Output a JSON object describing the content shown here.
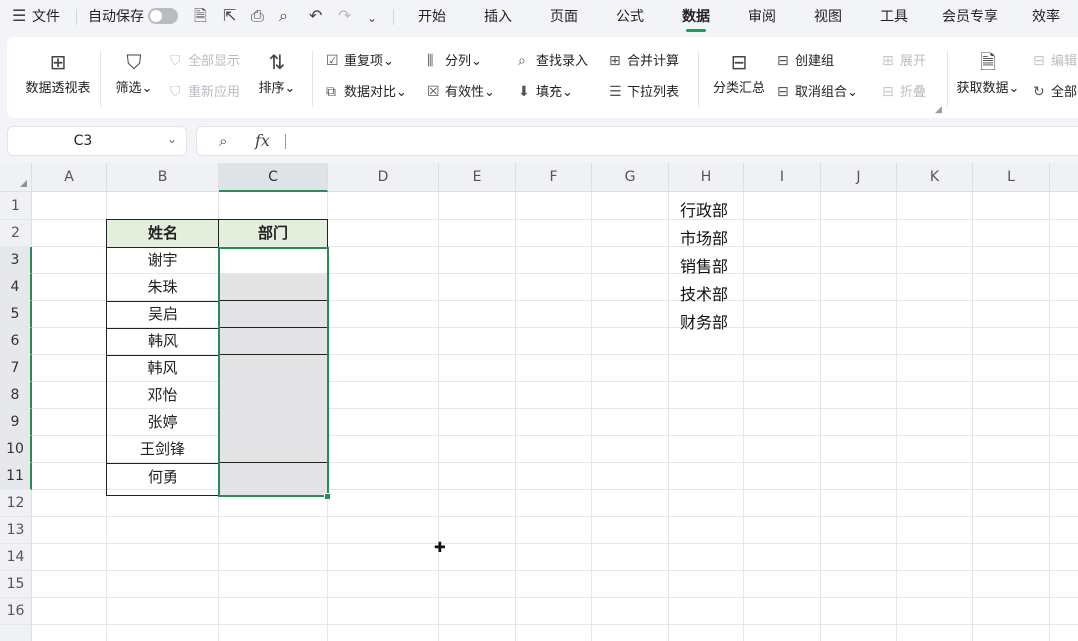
{
  "menubar": {
    "menu_icon": "☰",
    "file": "文件",
    "autosave": "自动保存",
    "tabs": [
      "开始",
      "插入",
      "页面",
      "公式",
      "数据",
      "审阅",
      "视图",
      "工具",
      "会员专享",
      "效率"
    ],
    "active_tab": "数据"
  },
  "ribbon": {
    "pivot": "数据透视表",
    "filter": "筛选",
    "show_all": "全部显示",
    "reapply": "重新应用",
    "sort": "排序",
    "duplicates": "重复项",
    "compare": "数据对比",
    "split": "分列",
    "validity": "有效性",
    "lookup": "查找录入",
    "fill": "填充",
    "consolidate": "合并计算",
    "dropdown": "下拉列表",
    "subtotal": "分类汇总",
    "group": "创建组",
    "ungroup": "取消组合",
    "expand": "展开",
    "collapse": "折叠",
    "get_data": "获取数据",
    "edit": "编辑",
    "all": "全部"
  },
  "formula_bar": {
    "name_box": "C3",
    "fx": "fx",
    "value": ""
  },
  "columns": [
    "A",
    "B",
    "C",
    "D",
    "E",
    "F",
    "G",
    "H",
    "I",
    "J",
    "K",
    "L"
  ],
  "selected_column": "C",
  "rows": [
    "1",
    "2",
    "3",
    "4",
    "5",
    "6",
    "7",
    "8",
    "9",
    "10",
    "11",
    "12",
    "13",
    "14",
    "15",
    "16"
  ],
  "table": {
    "header_name": "姓名",
    "header_dept": "部门",
    "names": [
      "谢宇",
      "朱珠",
      "吴启",
      "韩风",
      "韩风",
      "邓怡",
      "张婷",
      "王剑锋",
      "何勇"
    ]
  },
  "departments": [
    "行政部",
    "市场部",
    "销售部",
    "技术部",
    "财务部"
  ],
  "colors": {
    "accent": "#1f9d55",
    "header_fill": "#e3efdc",
    "selection_fill": "#e4e4e6"
  }
}
